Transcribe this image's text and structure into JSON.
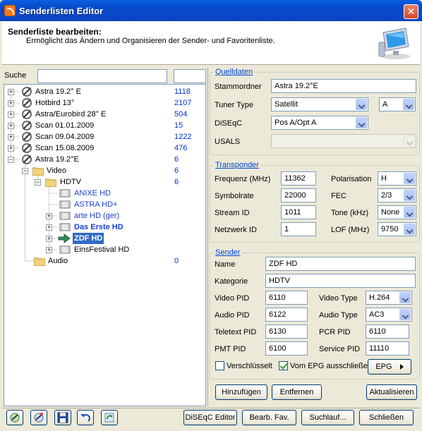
{
  "window": {
    "title": "Senderlisten Editor",
    "close_glyph": "✕"
  },
  "header": {
    "title": "Senderliste bearbeiten:",
    "subtitle": "Ermöglicht das Ändern und Organisieren der Sender- und Favoritenliste."
  },
  "search": {
    "label": "Suche",
    "value": "",
    "value2": ""
  },
  "tree": {
    "rows": [
      {
        "label": "Astra 19.2° E",
        "count": "1118"
      },
      {
        "label": "Hotbird  13°",
        "count": "2107"
      },
      {
        "label": "Astra/Eurobird 28° E",
        "count": "504"
      },
      {
        "label": "Scan 01.01.2009",
        "count": "15"
      },
      {
        "label": "Scan 09.04.2009",
        "count": "1222"
      },
      {
        "label": "Scan 15.08.2009",
        "count": "476"
      },
      {
        "label": "Astra 19.2°E",
        "count": "6"
      },
      {
        "label": "Video",
        "count": "6"
      },
      {
        "label": "HDTV",
        "count": "6"
      },
      {
        "label": "ANIXE HD"
      },
      {
        "label": "ASTRA HD+"
      },
      {
        "label": "arte HD (ger)"
      },
      {
        "label": "Das Erste HD"
      },
      {
        "label": "ZDF HD"
      },
      {
        "label": "EinsFestival HD"
      },
      {
        "label": "Audio",
        "count": "0"
      }
    ],
    "expander_plus": "+",
    "expander_minus": "−"
  },
  "quelldaten": {
    "legend": "Quelldaten",
    "stammordner_label": "Stammordner",
    "stammordner_value": "Astra 19.2°E",
    "tuner_label": "Tuner Type",
    "tuner_value": "Satellit",
    "tuner_port": "A",
    "diseqc_label": "DiSEqC",
    "diseqc_value": "Pos A/Opt A",
    "usals_label": "USALS",
    "usals_value": ""
  },
  "transponder": {
    "legend": "Transponder",
    "freq_label": "Frequenz (MHz)",
    "freq_value": "11362",
    "pol_label": "Polarisation",
    "pol_value": "H",
    "sym_label": "Symbolrate",
    "sym_value": "22000",
    "fec_label": "FEC",
    "fec_value": "2/3",
    "stream_label": "Stream ID",
    "stream_value": "1011",
    "tone_label": "Tone (kHz)",
    "tone_value": "None",
    "net_label": "Netzwerk ID",
    "net_value": "1",
    "lof_label": "LOF  (MHz)",
    "lof_value": "9750"
  },
  "sender": {
    "legend": "Sender",
    "name_label": "Name",
    "name_value": "ZDF HD",
    "kat_label": "Kategorie",
    "kat_value": "HDTV",
    "vpid_label": "Video PID",
    "vpid_value": "6110",
    "vtype_label": "Video Type",
    "vtype_value": "H.264",
    "apid_label": "Audio PID",
    "apid_value": "6122",
    "atype_label": "Audio Type",
    "atype_value": "AC3",
    "tpid_label": "Teletext PID",
    "tpid_value": "6130",
    "pcr_label": "PCR PID",
    "pcr_value": "6110",
    "pmt_label": "PMT PID",
    "pmt_value": "6100",
    "sid_label": "Service PID",
    "sid_value": "11110",
    "encrypted_label": "Verschlüsselt",
    "encrypted": false,
    "epg_excl_label": "Vom EPG ausschließen",
    "epg_excl": true,
    "epg_button": "EPG"
  },
  "actions": {
    "add": "Hinzufügen",
    "remove": "Entfernen",
    "update": "Aktualisieren"
  },
  "footer": {
    "diseqc_editor": "DiSEqC Editor",
    "edit_fav": "Bearb. Fav.",
    "search": "Suchlauf...",
    "close": "Schließen"
  },
  "colors": {
    "accent": "#0046d5",
    "count": "#0033cc",
    "selection": "#316ac5",
    "titlebar": "#0548c6"
  }
}
